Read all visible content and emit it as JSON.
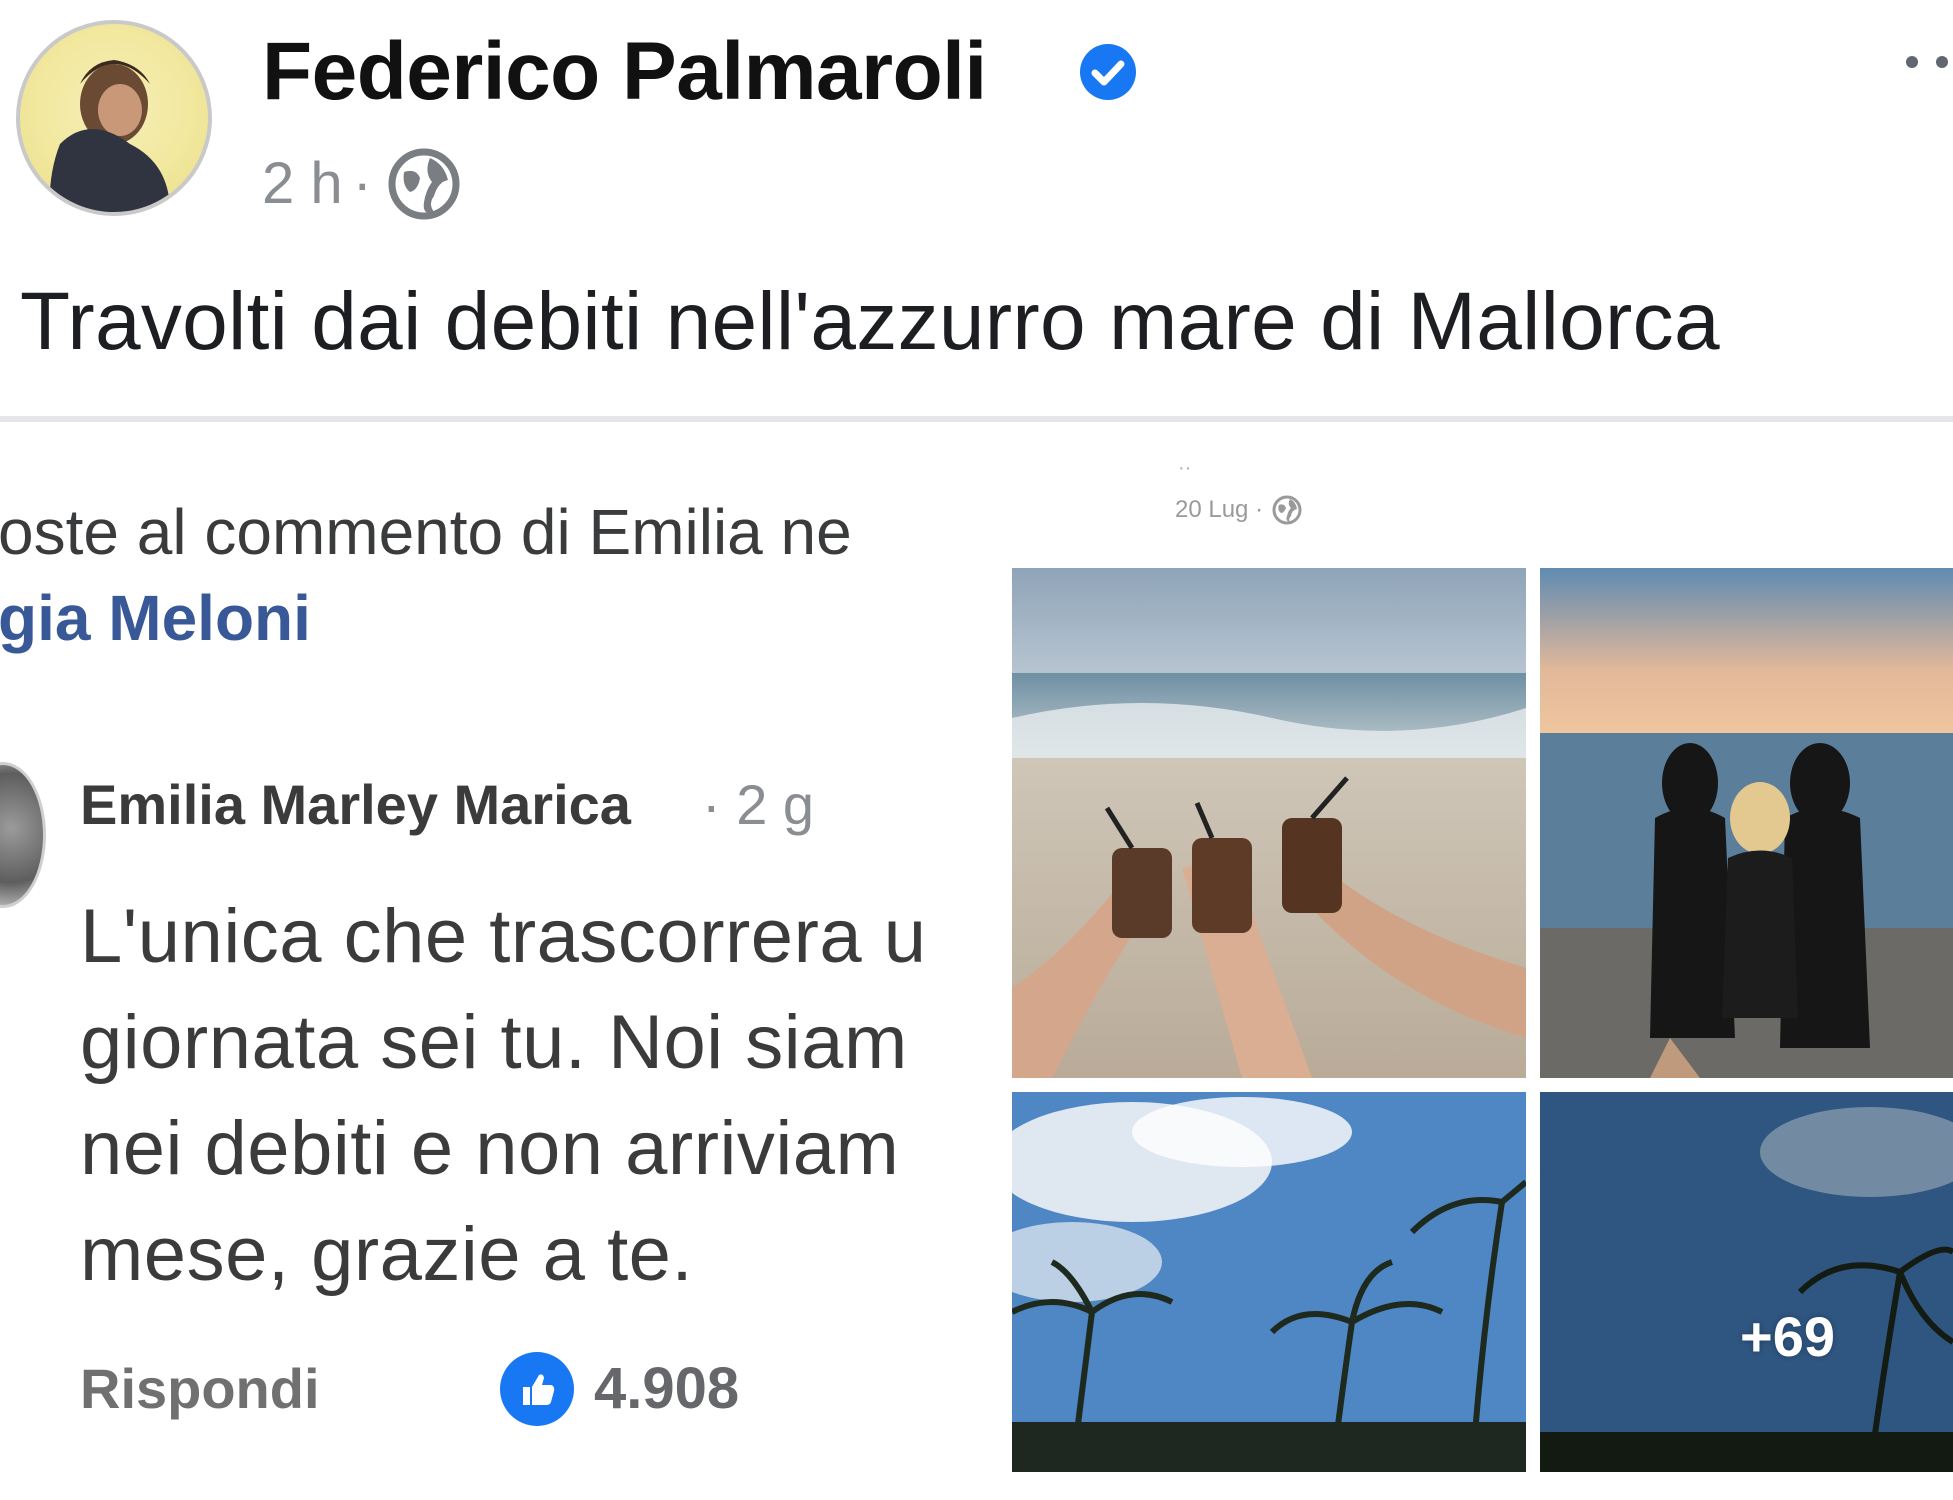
{
  "post": {
    "author": "Federico Palmaroli",
    "time": "2 h",
    "separator": "·",
    "text": "Travolti dai debiti nell'azzurro mare di Mallorca"
  },
  "comment_screenshot": {
    "heading": "oste al commento di Emilia ne",
    "link": "gia Meloni",
    "commenter": "Emilia Marley Marica",
    "time": "· 2 g",
    "lines": [
      "L'unica che trascorrera u",
      "giornata sei tu. Noi siam",
      "nei debiti e non arriviam",
      "mese, grazie a te."
    ],
    "reply_label": "Rispondi",
    "like_count": "4.908"
  },
  "photo_post": {
    "date": "20 Lug ·",
    "more_photos": "+69"
  },
  "colors": {
    "verified": "#1877f2",
    "link": "#385898",
    "meta": "#8a8d91"
  },
  "icons": [
    "verified-badge-icon",
    "more-options-icon",
    "globe-icon",
    "like-icon"
  ]
}
